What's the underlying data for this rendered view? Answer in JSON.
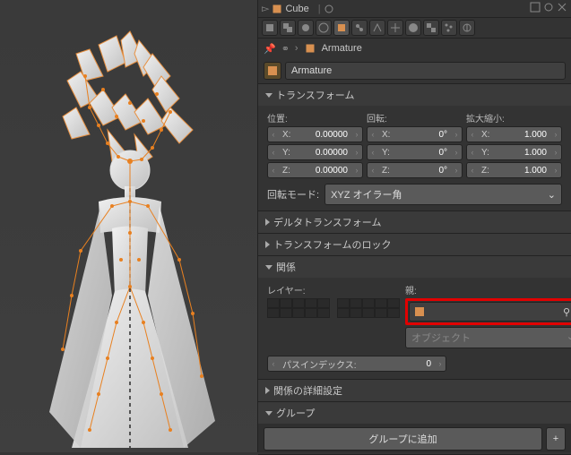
{
  "outliner": {
    "active": "Cube"
  },
  "breadcrumb": {
    "object": "Armature"
  },
  "name_field": "Armature",
  "sections": {
    "transform": "トランスフォーム",
    "delta": "デルタトランスフォーム",
    "lock": "トランスフォームのロック",
    "relations": "関係",
    "extras": "関係の詳細設定",
    "groups": "グループ"
  },
  "transform": {
    "loc_label": "位置:",
    "rot_label": "回転:",
    "scale_label": "拡大縮小:",
    "axes": [
      "X:",
      "Y:",
      "Z:"
    ],
    "loc": [
      "0.00000",
      "0.00000",
      "0.00000"
    ],
    "rot": [
      "0°",
      "0°",
      "0°"
    ],
    "scale": [
      "1.000",
      "1.000",
      "1.000"
    ],
    "rot_mode_label": "回転モード:",
    "rot_mode_value": "XYZ オイラー角"
  },
  "relations": {
    "layers_label": "レイヤー:",
    "parent_label": "親:",
    "parent_value": "",
    "parent_type": "オブジェクト",
    "pass_index_label": "パスインデックス:",
    "pass_index_value": "0"
  },
  "groups": {
    "add_label": "グループに追加",
    "plus": "+"
  }
}
